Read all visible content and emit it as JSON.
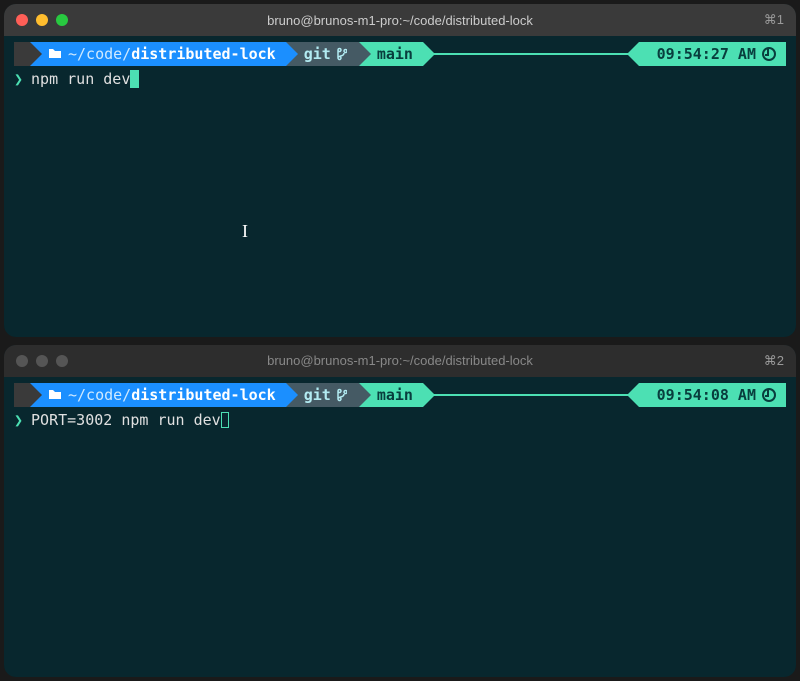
{
  "pane1": {
    "title": "bruno@brunos-m1-pro:~/code/distributed-lock",
    "tab_label": "⌘1",
    "apple_icon": "",
    "path_prefix": "~/code/",
    "path_name": "distributed-lock",
    "git_label": "git",
    "branch": "main",
    "time": "09:54:27 AM",
    "prompt_char": "❯",
    "command": "npm run dev",
    "active": true
  },
  "pane2": {
    "title": "bruno@brunos-m1-pro:~/code/distributed-lock",
    "tab_label": "⌘2",
    "apple_icon": "",
    "path_prefix": "~/code/",
    "path_name": "distributed-lock",
    "git_label": "git",
    "branch": "main",
    "time": "09:54:08 AM",
    "prompt_char": "❯",
    "command": "PORT=3002 npm run dev",
    "active": false
  }
}
